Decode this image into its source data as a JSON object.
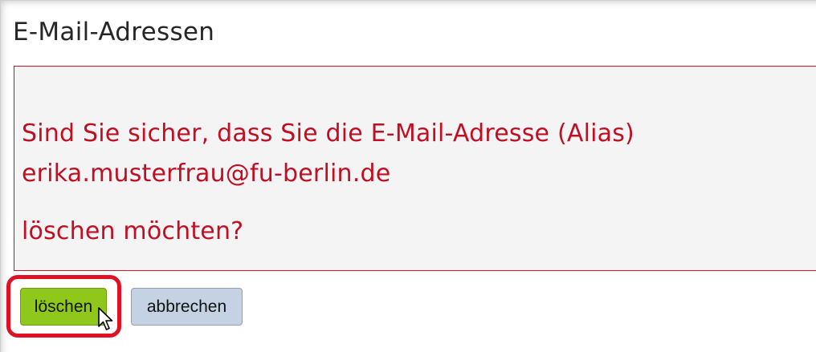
{
  "page": {
    "title": "E-Mail-Adressen"
  },
  "confirmation": {
    "line1": "Sind Sie sicher, dass Sie die E-Mail-Adresse (Alias)",
    "email": "erika.musterfrau@fu-berlin.de",
    "line3": "löschen möchten?"
  },
  "buttons": {
    "delete_label": "löschen",
    "cancel_label": "abbrechen"
  },
  "colors": {
    "alert_text": "#c00f22",
    "alert_border": "#c21526",
    "delete_button": "#8fc81a",
    "cancel_button": "#c4d2e4",
    "highlight_outline": "#e01122"
  },
  "icons": {
    "cursor": "mouse-pointer-icon"
  }
}
